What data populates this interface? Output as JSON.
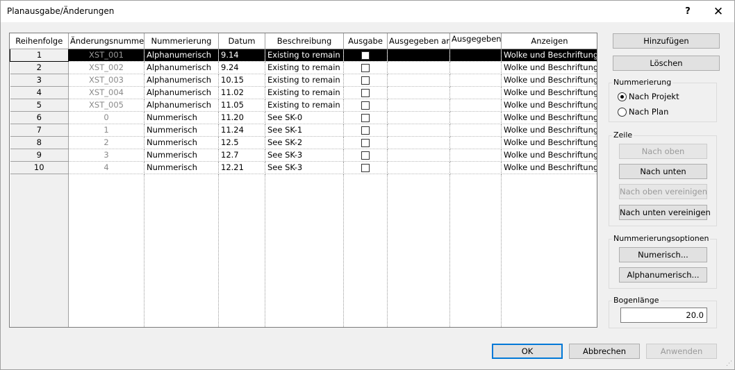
{
  "window": {
    "title": "Planausgabe/Änderungen",
    "help": "?",
    "close": "✕"
  },
  "grid": {
    "columns": [
      "Reihenfolge",
      "Änderungsnummer",
      "Nummerierung",
      "Datum",
      "Beschreibung",
      "Ausgabe",
      "Ausgegeben an",
      "Ausgegeben",
      "Anzeigen"
    ],
    "rows": [
      {
        "seq": "1",
        "num": "XST_001",
        "numbering": "Alphanumerisch",
        "date": "9.14",
        "desc": "Existing to remain",
        "issued": false,
        "issued_to": "",
        "issued_by": "",
        "show": "Wolke und Beschriftung"
      },
      {
        "seq": "2",
        "num": "XST_002",
        "numbering": "Alphanumerisch",
        "date": "9.24",
        "desc": "Existing to remain",
        "issued": false,
        "issued_to": "",
        "issued_by": "",
        "show": "Wolke und Beschriftung"
      },
      {
        "seq": "3",
        "num": "XST_003",
        "numbering": "Alphanumerisch",
        "date": "10.15",
        "desc": "Existing to remain",
        "issued": false,
        "issued_to": "",
        "issued_by": "",
        "show": "Wolke und Beschriftung"
      },
      {
        "seq": "4",
        "num": "XST_004",
        "numbering": "Alphanumerisch",
        "date": "11.02",
        "desc": "Existing to remain",
        "issued": false,
        "issued_to": "",
        "issued_by": "",
        "show": "Wolke und Beschriftung"
      },
      {
        "seq": "5",
        "num": "XST_005",
        "numbering": "Alphanumerisch",
        "date": "11.05",
        "desc": "Existing to remain",
        "issued": false,
        "issued_to": "",
        "issued_by": "",
        "show": "Wolke und Beschriftung"
      },
      {
        "seq": "6",
        "num": "0",
        "numbering": "Nummerisch",
        "date": "11.20",
        "desc": "See SK-0",
        "issued": false,
        "issued_to": "",
        "issued_by": "",
        "show": "Wolke und Beschriftung"
      },
      {
        "seq": "7",
        "num": "1",
        "numbering": "Nummerisch",
        "date": "11.24",
        "desc": "See SK-1",
        "issued": false,
        "issued_to": "",
        "issued_by": "",
        "show": "Wolke und Beschriftung"
      },
      {
        "seq": "8",
        "num": "2",
        "numbering": "Nummerisch",
        "date": "12.5",
        "desc": "See SK-2",
        "issued": false,
        "issued_to": "",
        "issued_by": "",
        "show": "Wolke und Beschriftung"
      },
      {
        "seq": "9",
        "num": "3",
        "numbering": "Nummerisch",
        "date": "12.7",
        "desc": "See SK-3",
        "issued": false,
        "issued_to": "",
        "issued_by": "",
        "show": "Wolke und Beschriftung"
      },
      {
        "seq": "10",
        "num": "4",
        "numbering": "Nummerisch",
        "date": "12.21",
        "desc": "See SK-3",
        "issued": false,
        "issued_to": "",
        "issued_by": "",
        "show": "Wolke und Beschriftung"
      }
    ],
    "selected_row": 0
  },
  "side": {
    "add": "Hinzufügen",
    "delete": "Löschen",
    "numbering_group": "Nummerierung",
    "by_project": "Nach Projekt",
    "by_sheet": "Nach Plan",
    "numbering_selected": "by_project",
    "row_group": "Zeile",
    "move_up": "Nach oben",
    "move_down": "Nach unten",
    "merge_up": "Nach oben vereinigen",
    "merge_down": "Nach unten vereinigen",
    "options_group": "Nummerierungsoptionen",
    "numeric": "Numerisch...",
    "alphanumeric": "Alphanumerisch...",
    "arc_group": "Bogenlänge",
    "arc_value": "20.0"
  },
  "footer": {
    "ok": "OK",
    "cancel": "Abbrechen",
    "apply": "Anwenden"
  }
}
